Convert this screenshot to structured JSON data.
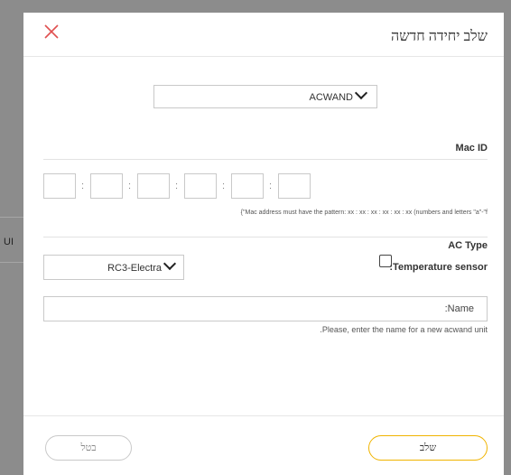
{
  "dialog": {
    "title": "שלב יחידה חדשה",
    "close_icon": "close-icon",
    "accent_color": "#e05050"
  },
  "unit_select": {
    "value": "ACWAND"
  },
  "mac": {
    "label": "Mac ID",
    "separator": ":",
    "hint": "{\"Mac address must have the pattern: xx : xx : xx : xx : xx : xx (numbers and letters \"a\"-\"f"
  },
  "ac_type": {
    "label": "AC Type",
    "value": "RC3-Electra"
  },
  "temperature_sensor": {
    "label": ":Temperature sensor",
    "checked": false
  },
  "name": {
    "placeholder": ":Name",
    "hint": ".Please, enter the name for a new acwand unit"
  },
  "buttons": {
    "cancel": "בטל",
    "save": "שלב"
  },
  "background": {
    "fragment": "UI"
  },
  "colors": {
    "save_border": "#f0b400",
    "border": "#c9c9c9"
  }
}
